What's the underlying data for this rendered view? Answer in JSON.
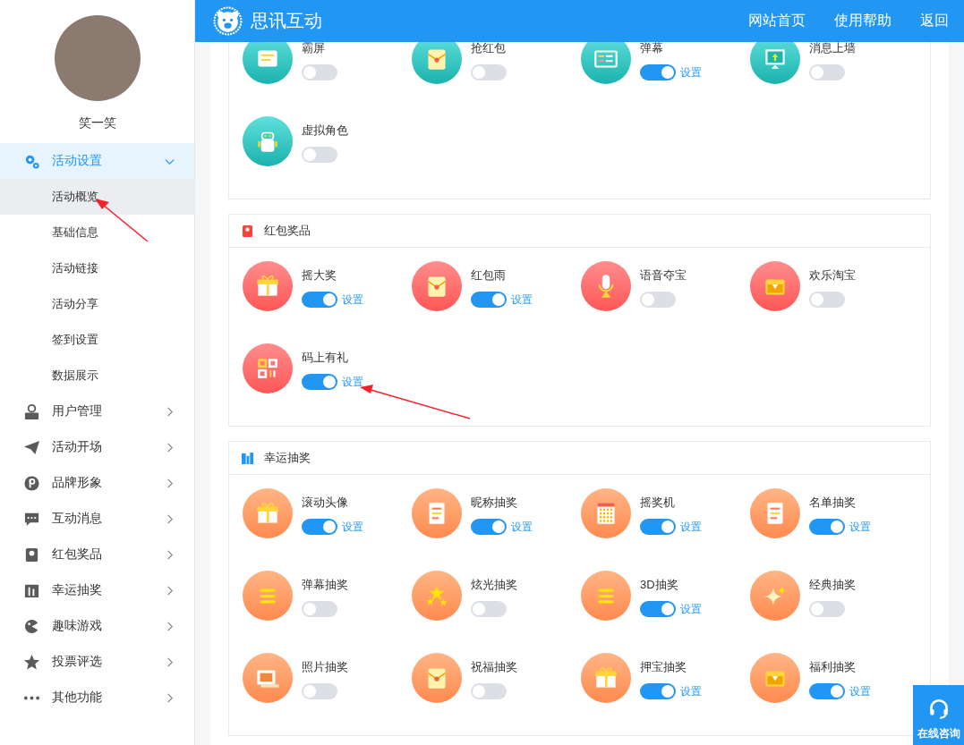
{
  "header": {
    "brand": "思讯互动",
    "nav": [
      "网站首页",
      "使用帮助",
      "返回"
    ]
  },
  "sidebar": {
    "user_name": "笑一笑",
    "menu": [
      {
        "label": "活动设置",
        "expanded": true,
        "children": [
          {
            "label": "活动概览",
            "selected": true
          },
          {
            "label": "基础信息",
            "selected": false
          },
          {
            "label": "活动链接",
            "selected": false
          },
          {
            "label": "活动分享",
            "selected": false
          },
          {
            "label": "签到设置",
            "selected": false
          },
          {
            "label": "数据展示",
            "selected": false
          }
        ]
      },
      {
        "label": "用户管理",
        "expanded": false
      },
      {
        "label": "活动开场",
        "expanded": false
      },
      {
        "label": "品牌形象",
        "expanded": false
      },
      {
        "label": "互动消息",
        "expanded": false
      },
      {
        "label": "红包奖品",
        "expanded": false
      },
      {
        "label": "幸运抽奖",
        "expanded": false
      },
      {
        "label": "趣味游戏",
        "expanded": false
      },
      {
        "label": "投票评选",
        "expanded": false
      },
      {
        "label": "其他功能",
        "expanded": false
      }
    ]
  },
  "sections": [
    {
      "items": [
        {
          "name": "霸屏",
          "on": false
        },
        {
          "name": "抢红包",
          "on": false
        },
        {
          "name": "弹幕",
          "on": true,
          "setting_link": "设置"
        },
        {
          "name": "消息上墙",
          "on": false
        },
        {
          "name": "虚拟角色",
          "on": false
        }
      ]
    },
    {
      "title": "红包奖品",
      "items": [
        {
          "name": "摇大奖",
          "on": true,
          "setting_link": "设置"
        },
        {
          "name": "红包雨",
          "on": true,
          "setting_link": "设置"
        },
        {
          "name": "语音夺宝",
          "on": false
        },
        {
          "name": "欢乐淘宝",
          "on": false
        },
        {
          "name": "码上有礼",
          "on": true,
          "setting_link": "设置"
        }
      ]
    },
    {
      "title": "幸运抽奖",
      "items": [
        {
          "name": "滚动头像",
          "on": true,
          "setting_link": "设置"
        },
        {
          "name": "昵称抽奖",
          "on": true,
          "setting_link": "设置"
        },
        {
          "name": "摇奖机",
          "on": true,
          "setting_link": "设置"
        },
        {
          "name": "名单抽奖",
          "on": true,
          "setting_link": "设置"
        },
        {
          "name": "弹幕抽奖",
          "on": false
        },
        {
          "name": "炫光抽奖",
          "on": false
        },
        {
          "name": "3D抽奖",
          "on": true,
          "setting_link": "设置"
        },
        {
          "name": "经典抽奖",
          "on": false
        },
        {
          "name": "照片抽奖",
          "on": false
        },
        {
          "name": "祝福抽奖",
          "on": false
        },
        {
          "name": "押宝抽奖",
          "on": true,
          "setting_link": "设置"
        },
        {
          "name": "福利抽奖",
          "on": true,
          "setting_link": "设置"
        }
      ]
    }
  ],
  "chat_button": {
    "label": "在线咨询"
  }
}
